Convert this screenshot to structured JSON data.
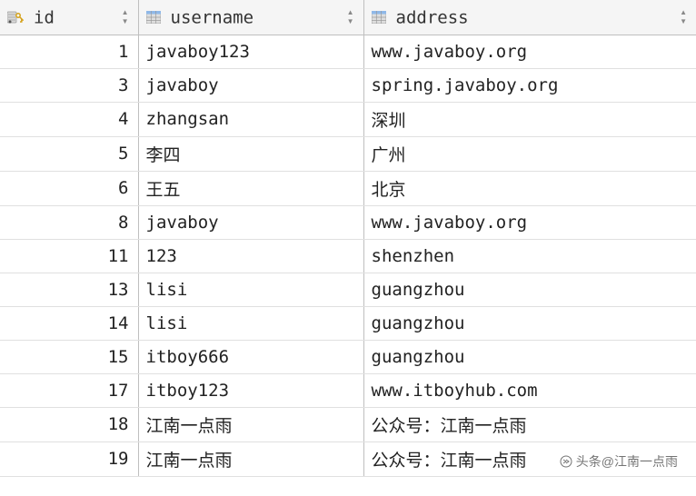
{
  "columns": {
    "id": {
      "label": "id"
    },
    "username": {
      "label": "username"
    },
    "address": {
      "label": "address"
    }
  },
  "rows": [
    {
      "id": "1",
      "username": "javaboy123",
      "address": "www.javaboy.org"
    },
    {
      "id": "3",
      "username": "javaboy",
      "address": "spring.javaboy.org"
    },
    {
      "id": "4",
      "username": "zhangsan",
      "address": "深圳"
    },
    {
      "id": "5",
      "username": "李四",
      "address": "广州"
    },
    {
      "id": "6",
      "username": "王五",
      "address": "北京"
    },
    {
      "id": "8",
      "username": "javaboy",
      "address": "www.javaboy.org"
    },
    {
      "id": "11",
      "username": "123",
      "address": "shenzhen"
    },
    {
      "id": "13",
      "username": "lisi",
      "address": "guangzhou"
    },
    {
      "id": "14",
      "username": "lisi",
      "address": "guangzhou"
    },
    {
      "id": "15",
      "username": "itboy666",
      "address": "guangzhou"
    },
    {
      "id": "17",
      "username": "itboy123",
      "address": "www.itboyhub.com"
    },
    {
      "id": "18",
      "username": "江南一点雨",
      "address": "公众号：江南一点雨"
    },
    {
      "id": "19",
      "username": "江南一点雨",
      "address": "公众号：江南一点雨"
    }
  ],
  "watermark": "头条@江南一点雨"
}
